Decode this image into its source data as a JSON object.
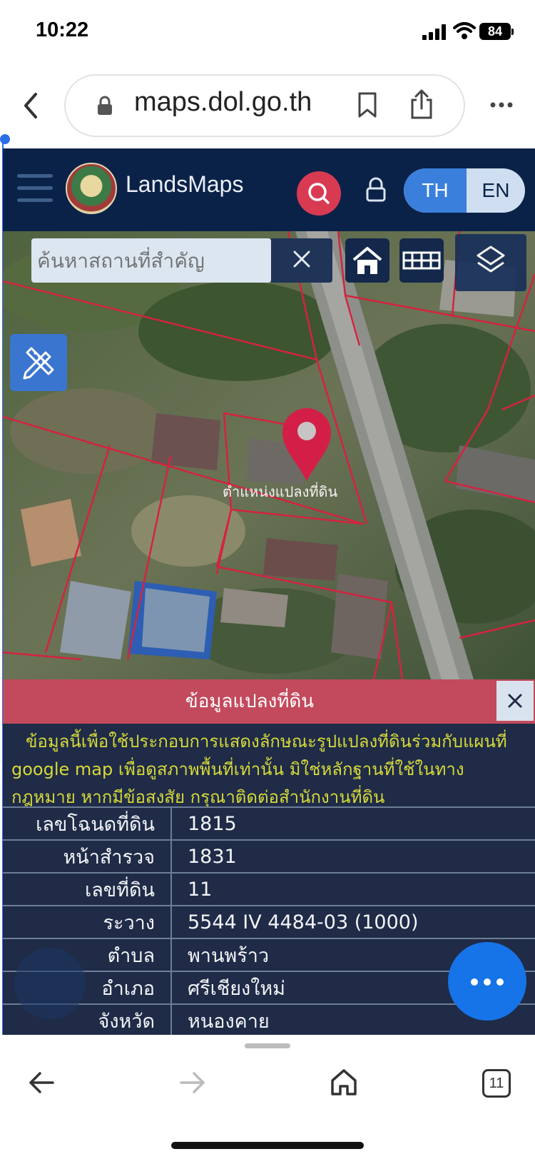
{
  "status_bar": {
    "time": "10:22",
    "battery": "84"
  },
  "browser": {
    "url": "maps.dol.go.th",
    "tab_count": "11"
  },
  "app": {
    "title": "LandsMaps",
    "lang_th": "TH",
    "lang_en": "EN",
    "map_search_placeholder": "ค้นหาสถานที่สำคัญ",
    "map_pin_label": "ตำแหน่งแปลงที่ดิน"
  },
  "info_panel": {
    "title": "ข้อมูลแปลงที่ดิน",
    "notice_lines": [
      "ข้อมูลนี้เพื่อใช้ประกอบการแสดงลักษณะรูปแปลงที่ดินร่วมกับแผนที่",
      "google map เพื่อดูสภาพพื้นที่เท่านั้น มิใช่หลักฐานที่ใช้ในทาง",
      "กฎหมาย หากมีข้อสงสัย กรุณาติดต่อสำนักงานที่ดิน"
    ],
    "rows": [
      {
        "label": "เลขโฉนดที่ดิน",
        "value": "1815"
      },
      {
        "label": "หน้าสำรวจ",
        "value": "1831"
      },
      {
        "label": "เลขที่ดิน",
        "value": "11"
      },
      {
        "label": "ระวาง",
        "value": "5544 IV 4484-03 (1000)"
      },
      {
        "label": "ตำบล",
        "value": "พานพร้าว"
      },
      {
        "label": "อำเภอ",
        "value": "ศรีเชียงใหม่"
      },
      {
        "label": "จังหวัด",
        "value": "หนองคาย"
      }
    ]
  },
  "icons": {
    "search": "search-icon",
    "lock": "lock-icon",
    "home": "home-icon",
    "grid": "grid-icon",
    "layers": "layers-icon",
    "measure": "pencil-ruler-icon",
    "close": "close-icon",
    "more": "more-icon"
  },
  "colors": {
    "header_bg": "#0b2248",
    "accent_red": "#d83a52",
    "info_header": "#c24a5c",
    "notice_text": "#d6d93a",
    "fab_blue": "#1674e8"
  }
}
